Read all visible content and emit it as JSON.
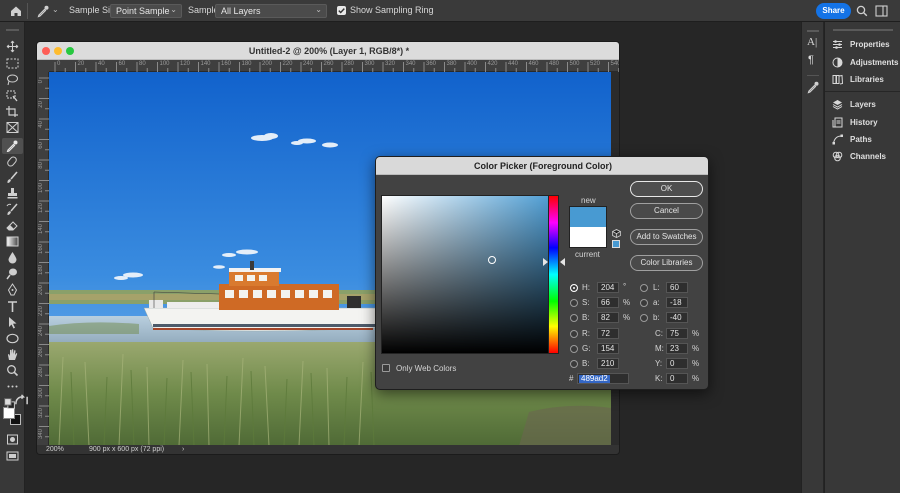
{
  "options_bar": {
    "sample_size_label": "Sample Size:",
    "sample_size_value": "Point Sample",
    "sample_label": "Sample:",
    "sample_value": "All Layers",
    "sampling_ring_label": "Show Sampling Ring",
    "share_label": "Share"
  },
  "document": {
    "title": "Untitled-2 @ 200% (Layer 1, RGB/8*) *",
    "zoom": "200%",
    "info": "900 px x 600 px (72 ppi)",
    "ruler_h": [
      "0",
      "20",
      "40",
      "60",
      "80",
      "100",
      "120",
      "140",
      "160",
      "180",
      "200",
      "220",
      "240",
      "260",
      "280",
      "300",
      "320",
      "340",
      "360",
      "380",
      "400",
      "420",
      "440",
      "460",
      "480",
      "500",
      "520",
      "540"
    ],
    "ruler_v": [
      "0",
      "20",
      "40",
      "60",
      "80",
      "100",
      "120",
      "140",
      "160",
      "180",
      "200",
      "220",
      "240",
      "260",
      "280",
      "300",
      "320",
      "340",
      "360"
    ]
  },
  "panels": {
    "items": [
      {
        "label": "Properties",
        "icon": "properties-icon"
      },
      {
        "label": "Adjustments",
        "icon": "adjustments-icon"
      },
      {
        "label": "Libraries",
        "icon": "libraries-icon"
      },
      {
        "label": "Layers",
        "icon": "layers-icon"
      },
      {
        "label": "History",
        "icon": "history-icon"
      },
      {
        "label": "Paths",
        "icon": "paths-icon"
      },
      {
        "label": "Channels",
        "icon": "channels-icon"
      }
    ]
  },
  "color_picker": {
    "title": "Color Picker (Foreground Color)",
    "new_label": "new",
    "current_label": "current",
    "new_color": "#489ad2",
    "current_color": "#ffffff",
    "ok_label": "OK",
    "cancel_label": "Cancel",
    "add_swatches_label": "Add to Swatches",
    "color_libraries_label": "Color Libraries",
    "only_web_colors_label": "Only Web Colors",
    "hsb": [
      {
        "label": "H:",
        "value": "204",
        "unit": "°"
      },
      {
        "label": "S:",
        "value": "66",
        "unit": "%"
      },
      {
        "label": "B:",
        "value": "82",
        "unit": "%"
      }
    ],
    "rgb": [
      {
        "label": "R:",
        "value": "72"
      },
      {
        "label": "G:",
        "value": "154"
      },
      {
        "label": "B:",
        "value": "210"
      }
    ],
    "lab": [
      {
        "label": "L:",
        "value": "60"
      },
      {
        "label": "a:",
        "value": "-18"
      },
      {
        "label": "b:",
        "value": "-40"
      }
    ],
    "cmyk": [
      {
        "label": "C:",
        "value": "75",
        "unit": "%"
      },
      {
        "label": "M:",
        "value": "23",
        "unit": "%"
      },
      {
        "label": "Y:",
        "value": "0",
        "unit": "%"
      },
      {
        "label": "K:",
        "value": "0",
        "unit": "%"
      }
    ],
    "hex_label": "#",
    "hex_value": "489ad2"
  },
  "colors": {
    "accent": "#1473e6",
    "panel_bg": "#383838",
    "workspace_bg": "#262626"
  }
}
